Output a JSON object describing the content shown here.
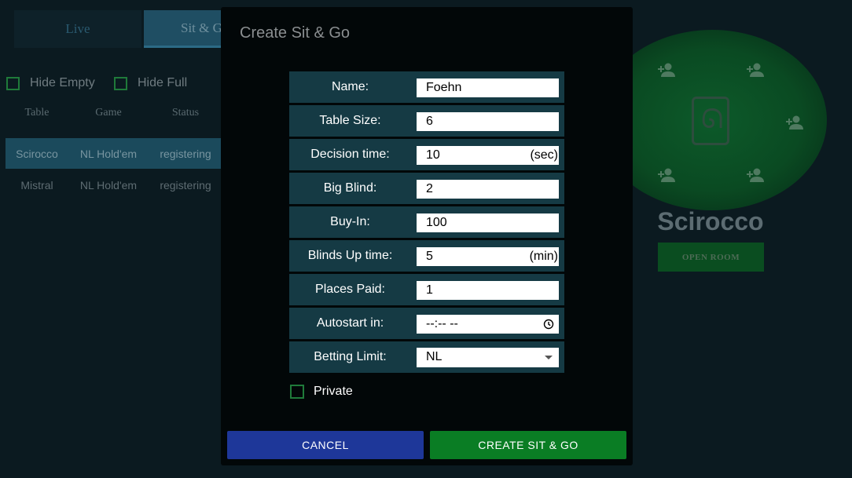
{
  "lobby": {
    "tabs": [
      {
        "label": "Live"
      },
      {
        "label": "Sit & Go"
      }
    ],
    "filters": {
      "hide_empty": "Hide Empty",
      "hide_full": "Hide Full"
    },
    "table_headers": [
      "Table",
      "Game",
      "Status"
    ],
    "rows": [
      {
        "table": "Scirocco",
        "game": "NL Hold'em",
        "status": "registering"
      },
      {
        "table": "Mistral",
        "game": "NL Hold'em",
        "status": "registering"
      }
    ],
    "preview": {
      "room_name": "Scirocco",
      "open_room_label": "OPEN ROOM",
      "seat_icon": "add-person-icon",
      "logo_icon": "card-logo-icon"
    }
  },
  "modal": {
    "title": "Create Sit & Go",
    "fields": [
      {
        "label": "Name:",
        "value": "Foehn"
      },
      {
        "label": "Table Size:",
        "value": "6"
      },
      {
        "label": "Decision time:",
        "value": "10",
        "unit": "(sec)"
      },
      {
        "label": "Big Blind:",
        "value": "2"
      },
      {
        "label": "Buy-In:",
        "value": "100"
      },
      {
        "label": "Blinds Up time:",
        "value": "5",
        "unit": "(min)"
      },
      {
        "label": "Places Paid:",
        "value": "1"
      },
      {
        "label": "Autostart in:",
        "value": "--:-- --"
      },
      {
        "label": "Betting Limit:",
        "value": "NL"
      }
    ],
    "private_label": "Private",
    "cancel_label": "CANCEL",
    "create_label": "CREATE SIT & GO"
  },
  "colors": {
    "background": "#0b1a20",
    "modal": "#020708",
    "row": "#153a44",
    "cancel": "#1e3799",
    "create": "#0a7d24",
    "checkbox": "#1f7a3a"
  }
}
